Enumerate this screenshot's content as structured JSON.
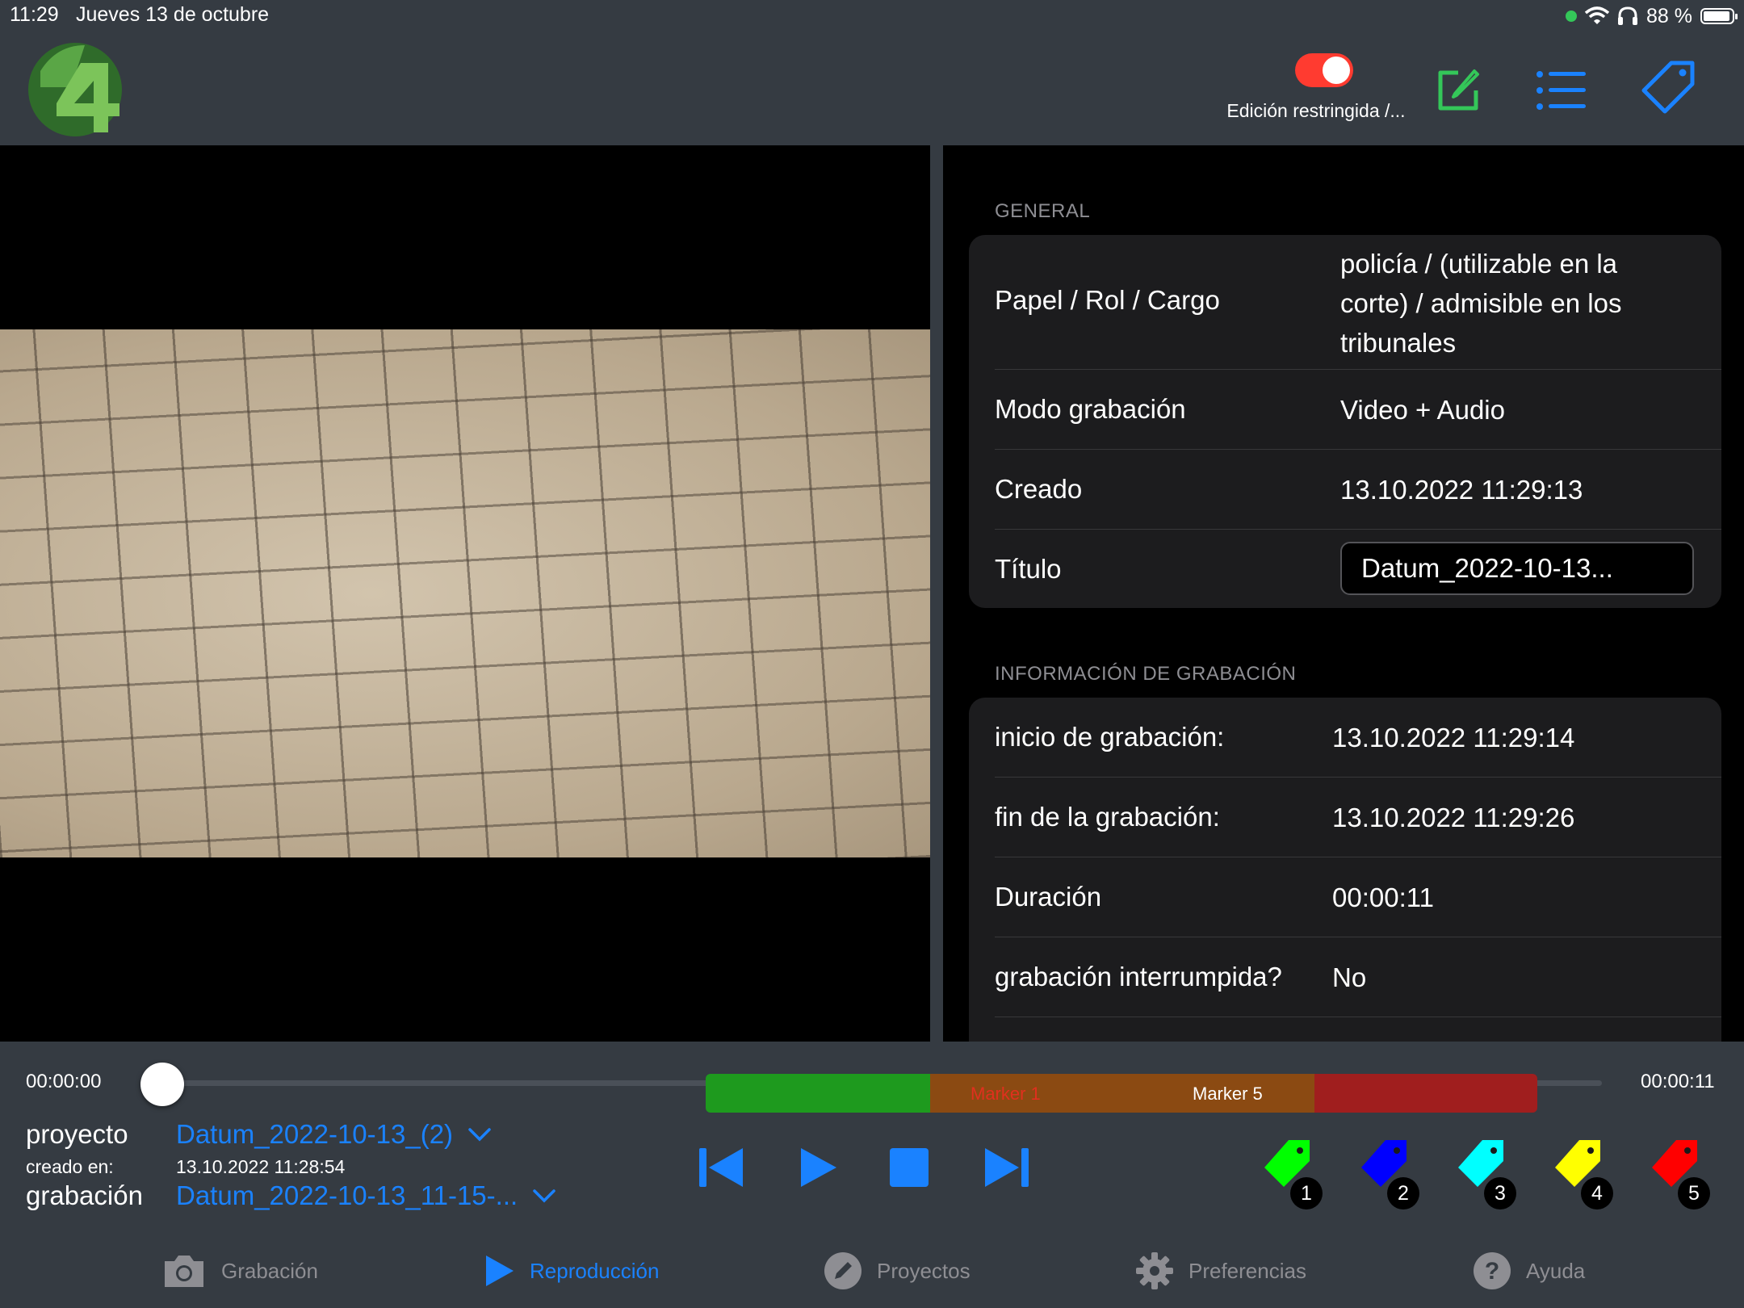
{
  "status_bar": {
    "time": "11:29",
    "date": "Jueves 13 de octubre",
    "battery": "88 %"
  },
  "header": {
    "toggle_label": "Edición restringida /...",
    "toggle_on": true,
    "colors": {
      "toggle": "#ff3b30",
      "edit_icon": "#34c759",
      "accent": "#1a82ff"
    }
  },
  "general": {
    "header": "GENERAL",
    "rows": [
      {
        "key": "Papel / Rol / Cargo",
        "value_lines": [
          "policía / (utilizable en la",
          "corte) / admisible en los",
          "tribunales"
        ]
      },
      {
        "key": "Modo grabación",
        "value": "Video + Audio"
      },
      {
        "key": "Creado",
        "value": "13.10.2022 11:29:13"
      },
      {
        "key": "Título",
        "input_value": "Datum_2022-10-13..."
      }
    ]
  },
  "recording_info": {
    "header": "INFORMACIÓN DE GRABACIÓN",
    "rows": [
      {
        "key": "inicio de grabación:",
        "value": "13.10.2022 11:29:14"
      },
      {
        "key": "fin de la grabación:",
        "value": "13.10.2022 11:29:26"
      },
      {
        "key": "Duración",
        "value": "00:00:11"
      },
      {
        "key": "grabación interrumpida?",
        "value": "No"
      }
    ]
  },
  "player": {
    "time_start": "00:00:00",
    "time_end": "00:00:11",
    "markers": [
      {
        "label": "",
        "color": "#1e9a1e"
      },
      {
        "label": "Marker 1",
        "color": "#8b4a12",
        "label_color": "#e0301e"
      },
      {
        "label": "Marker 5",
        "color": "#8b4a12",
        "label_color": "#ffffff"
      },
      {
        "label": "",
        "color": "#a01e1e"
      }
    ]
  },
  "project": {
    "label": "proyecto",
    "value": "Datum_2022-10-13_(2)",
    "created_label": "creado en:",
    "created_value": "13.10.2022 11:28:54",
    "recording_label": "grabación",
    "recording_value": "Datum_2022-10-13_11-15-..."
  },
  "marker_buttons": [
    {
      "number": "1",
      "color": "#00ff00"
    },
    {
      "number": "2",
      "color": "#0000ff"
    },
    {
      "number": "3",
      "color": "#00ffff"
    },
    {
      "number": "4",
      "color": "#ffff00"
    },
    {
      "number": "5",
      "color": "#ff0000"
    }
  ],
  "tabs": [
    {
      "label": "Grabación",
      "icon": "camera-icon",
      "active": false
    },
    {
      "label": "Reproducción",
      "icon": "play-icon",
      "active": true
    },
    {
      "label": "Proyectos",
      "icon": "pencil-icon",
      "active": false
    },
    {
      "label": "Preferencias",
      "icon": "gear-icon",
      "active": false
    },
    {
      "label": "Ayuda",
      "icon": "help-icon",
      "active": false
    }
  ]
}
